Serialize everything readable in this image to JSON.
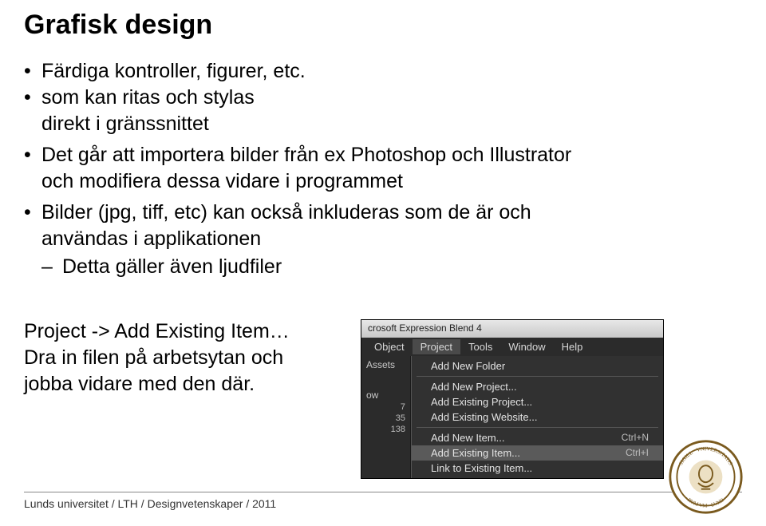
{
  "title": "Grafisk design",
  "bullets": {
    "b1": "Färdiga kontroller, figurer, etc.",
    "b2a": "som kan ritas och stylas",
    "b2b": "direkt i gränssnittet",
    "b3a": "Det går att importera bilder från ex Photoshop och Illustrator",
    "b3b": "och modifiera dessa vidare i programmet",
    "b4a": "Bilder (jpg, tiff, etc) kan också inkluderas som de är och",
    "b4b": "användas i applikationen",
    "b4sub": "Detta gäller även ljudfiler"
  },
  "body2": {
    "l1": "Project -> Add Existing Item…",
    "l2": "Dra in filen på arbetsytan och",
    "l3": "jobba vidare med den där."
  },
  "app": {
    "title": "crosoft Expression Blend 4",
    "menubar": [
      "Object",
      "Project",
      "Tools",
      "Window",
      "Help"
    ],
    "side": {
      "tab": "Assets",
      "label": "ow",
      "n1": "7",
      "n2": "35",
      "n3": "138"
    },
    "menu": [
      {
        "label": "Add New Folder",
        "kb": ""
      },
      {
        "sep": true
      },
      {
        "label": "Add New Project...",
        "kb": ""
      },
      {
        "label": "Add Existing Project...",
        "kb": ""
      },
      {
        "label": "Add Existing Website...",
        "kb": ""
      },
      {
        "sep": true
      },
      {
        "label": "Add New Item...",
        "kb": "Ctrl+N"
      },
      {
        "label": "Add Existing Item...",
        "kb": "Ctrl+I",
        "sel": true
      },
      {
        "label": "Link to Existing Item...",
        "kb": ""
      }
    ]
  },
  "footer": "Lunds universitet / LTH / Designvetenskaper / 2011"
}
